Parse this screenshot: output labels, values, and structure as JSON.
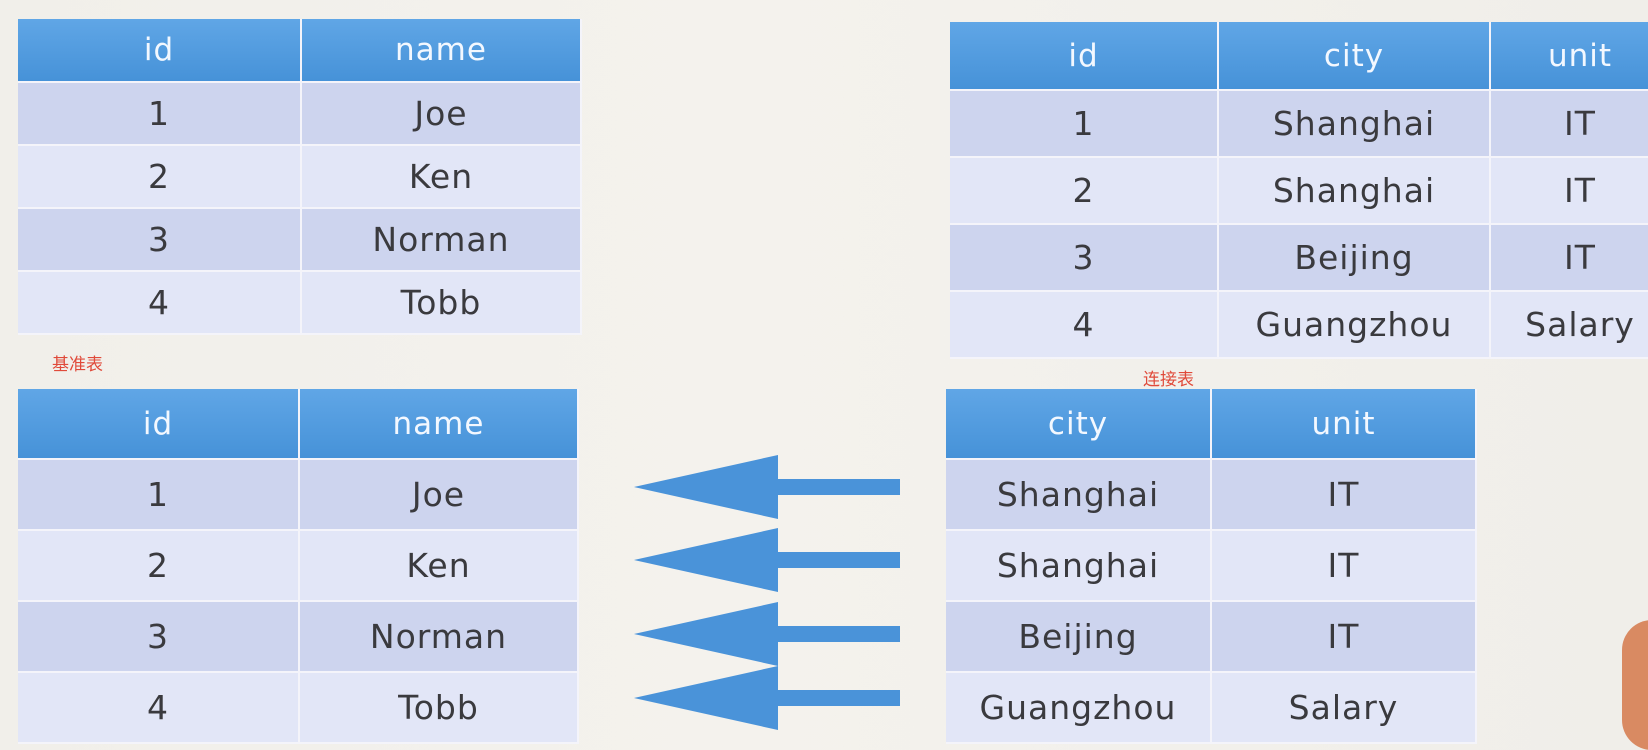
{
  "base_table_top": {
    "headers": [
      "id",
      "name"
    ],
    "rows": [
      [
        "1",
        "Joe"
      ],
      [
        "2",
        "Ken"
      ],
      [
        "3",
        "Norman"
      ],
      [
        "4",
        "Tobb"
      ]
    ]
  },
  "join_table_top": {
    "headers": [
      "id",
      "city",
      "unit"
    ],
    "rows": [
      [
        "1",
        "Shanghai",
        "IT"
      ],
      [
        "2",
        "Shanghai",
        "IT"
      ],
      [
        "3",
        "Beijing",
        "IT"
      ],
      [
        "4",
        "Guangzhou",
        "Salary"
      ]
    ]
  },
  "base_table_bottom": {
    "headers": [
      "id",
      "name"
    ],
    "rows": [
      [
        "1",
        "Joe"
      ],
      [
        "2",
        "Ken"
      ],
      [
        "3",
        "Norman"
      ],
      [
        "4",
        "Tobb"
      ]
    ]
  },
  "join_table_bottom": {
    "headers": [
      "city",
      "unit"
    ],
    "rows": [
      [
        "Shanghai",
        "IT"
      ],
      [
        "Shanghai",
        "IT"
      ],
      [
        "Beijing",
        "IT"
      ],
      [
        "Guangzhou",
        "Salary"
      ]
    ]
  },
  "captions": {
    "base": "基准表",
    "join": "连接表"
  },
  "colors": {
    "header": "#4a94db",
    "row_odd": "#cdd4ee",
    "row_even": "#e2e6f7",
    "arrow": "#4a93d9",
    "caption": "#e04a3a"
  },
  "arrows": {
    "count": 4,
    "direction": "left"
  }
}
